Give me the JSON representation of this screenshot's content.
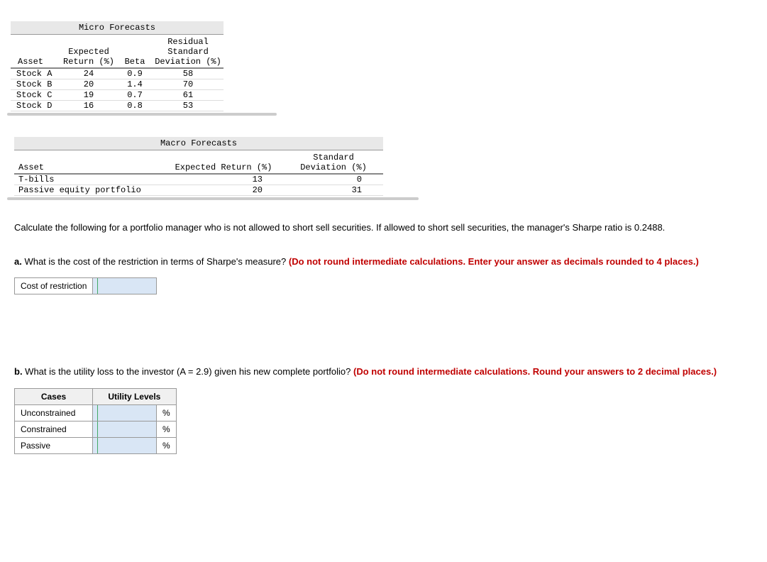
{
  "micro": {
    "title": "Micro Forecasts",
    "headers": {
      "asset": "Asset",
      "ret": "Expected\nReturn (%)",
      "beta": "Beta",
      "rsd": "Residual\nStandard\nDeviation (%)"
    },
    "rows": [
      {
        "asset": "Stock A",
        "ret": "24",
        "beta": "0.9",
        "rsd": "58"
      },
      {
        "asset": "Stock B",
        "ret": "20",
        "beta": "1.4",
        "rsd": "70"
      },
      {
        "asset": "Stock C",
        "ret": "19",
        "beta": "0.7",
        "rsd": "61"
      },
      {
        "asset": "Stock D",
        "ret": "16",
        "beta": "0.8",
        "rsd": "53"
      }
    ]
  },
  "macro": {
    "title": "Macro Forecasts",
    "headers": {
      "asset": "Asset",
      "ret": "Expected Return (%)",
      "sd": "Standard\nDeviation (%)"
    },
    "rows": [
      {
        "asset": "T-bills",
        "ret": "13",
        "sd": "0"
      },
      {
        "asset": "Passive equity portfolio",
        "ret": "20",
        "sd": "31"
      }
    ]
  },
  "intro": "Calculate the following for a portfolio manager who is not allowed to short sell securities. If allowed to short sell securities, the manager's Sharpe ratio is 0.2488.",
  "qa": {
    "label": "a.",
    "text": " What is the cost of the restriction in terms of Sharpe's measure? ",
    "hint": "(Do not round intermediate calculations. Enter your answer as decimals rounded to 4 places.)",
    "cost_label": "Cost of restriction"
  },
  "qb": {
    "label": "b.",
    "text": " What is the utility loss to the investor (A = 2.9) given his new complete portfolio? ",
    "hint": "(Do not round intermediate calculations. Round your answers to 2 decimal places.)",
    "th_cases": "Cases",
    "th_util": "Utility Levels",
    "rows": [
      "Unconstrained",
      "Constrained",
      "Passive"
    ],
    "pct": "%"
  }
}
